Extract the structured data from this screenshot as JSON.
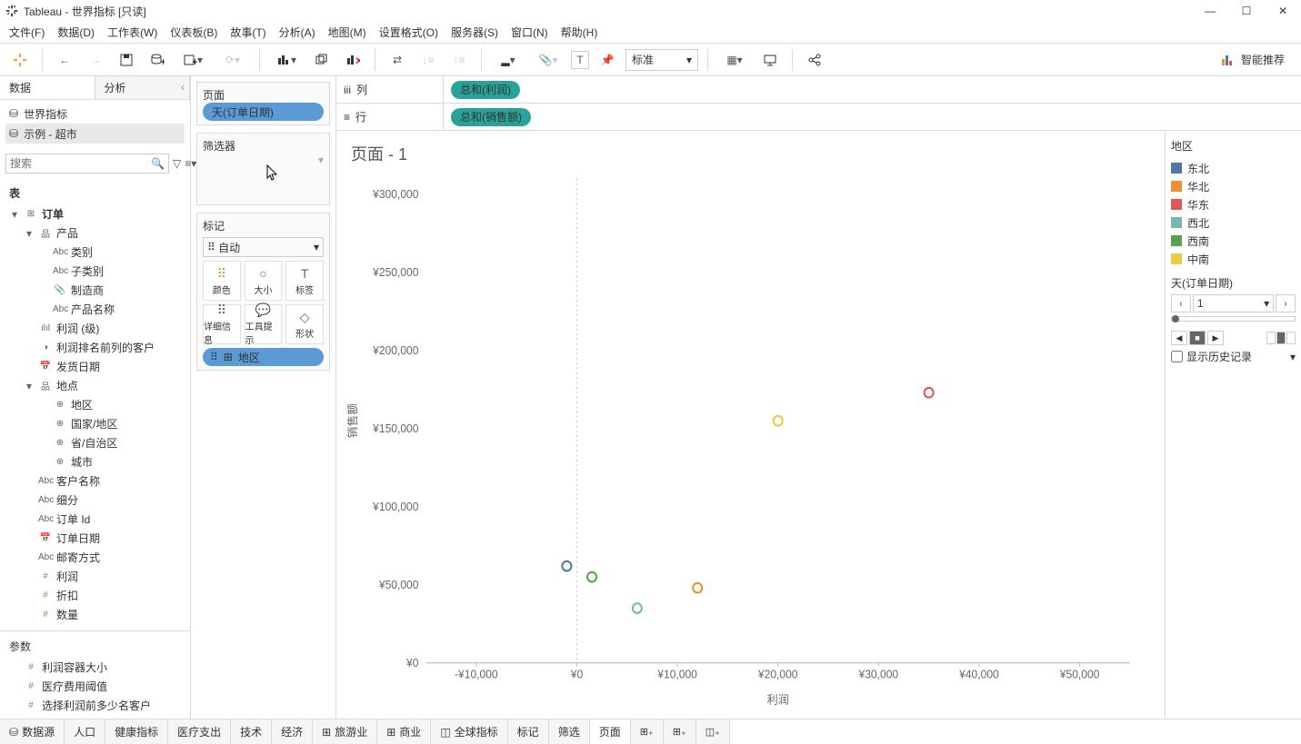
{
  "window": {
    "title": "Tableau - 世界指标 [只读]"
  },
  "menu": [
    "文件(F)",
    "数据(D)",
    "工作表(W)",
    "仪表板(B)",
    "故事(T)",
    "分析(A)",
    "地图(M)",
    "设置格式(O)",
    "服务器(S)",
    "窗口(N)",
    "帮助(H)"
  ],
  "toolbar": {
    "fit": "标准",
    "showme": "智能推荐"
  },
  "left": {
    "data_tab": "数据",
    "analytics_tab": "分析",
    "datasources": [
      {
        "name": "世界指标",
        "selected": false
      },
      {
        "name": "示例 - 超市",
        "selected": true
      }
    ],
    "search_placeholder": "搜索",
    "tables_header": "表",
    "tree": [
      {
        "level": 0,
        "expand": "▾",
        "icon": "⊞",
        "label": "订单",
        "bold": true
      },
      {
        "level": 1,
        "expand": "▾",
        "icon": "品",
        "label": "产品"
      },
      {
        "level": 2,
        "expand": "",
        "icon": "Abc",
        "label": "类别"
      },
      {
        "level": 2,
        "expand": "",
        "icon": "Abc",
        "label": "子类别"
      },
      {
        "level": 2,
        "expand": "",
        "icon": "📎",
        "label": "制造商"
      },
      {
        "level": 2,
        "expand": "",
        "icon": "Abc",
        "label": "产品名称"
      },
      {
        "level": 1,
        "expand": "",
        "icon": "ılıl",
        "label": "利润 (级)"
      },
      {
        "level": 1,
        "expand": "",
        "icon": "◑",
        "label": "利润排名前列的客户"
      },
      {
        "level": 1,
        "expand": "",
        "icon": "📅",
        "label": "发货日期"
      },
      {
        "level": 1,
        "expand": "▾",
        "icon": "品",
        "label": "地点"
      },
      {
        "level": 2,
        "expand": "",
        "icon": "⊕",
        "label": "地区"
      },
      {
        "level": 2,
        "expand": "",
        "icon": "⊕",
        "label": "国家/地区"
      },
      {
        "level": 2,
        "expand": "",
        "icon": "⊕",
        "label": "省/自治区"
      },
      {
        "level": 2,
        "expand": "",
        "icon": "⊕",
        "label": "城市"
      },
      {
        "level": 1,
        "expand": "",
        "icon": "Abc",
        "label": "客户名称"
      },
      {
        "level": 1,
        "expand": "",
        "icon": "Abc",
        "label": "细分"
      },
      {
        "level": 1,
        "expand": "",
        "icon": "Abc",
        "label": "订单 Id"
      },
      {
        "level": 1,
        "expand": "",
        "icon": "📅",
        "label": "订单日期"
      },
      {
        "level": 1,
        "expand": "",
        "icon": "Abc",
        "label": "邮寄方式"
      },
      {
        "level": 1,
        "expand": "",
        "icon": "#",
        "label": "利润",
        "green": true
      },
      {
        "level": 1,
        "expand": "",
        "icon": "#",
        "label": "折扣",
        "green": true
      },
      {
        "level": 1,
        "expand": "",
        "icon": "#",
        "label": "数量",
        "green": true
      }
    ],
    "params_header": "参数",
    "params": [
      {
        "icon": "#",
        "label": "利润容器大小"
      },
      {
        "icon": "#",
        "label": "医疗费用阈值"
      },
      {
        "icon": "#",
        "label": "选择利润前多少名客户"
      }
    ]
  },
  "cards": {
    "pages": {
      "title": "页面",
      "pill": "天(订单日期)"
    },
    "filters": {
      "title": "筛选器"
    },
    "marks": {
      "title": "标记",
      "type": "自动",
      "cells": [
        "颜色",
        "大小",
        "标签",
        "详细信息",
        "工具提示",
        "形状"
      ],
      "pill": {
        "icon": "∷",
        "field_icon": "⊞",
        "label": "地区"
      }
    }
  },
  "shelves": {
    "columns": {
      "label": "列",
      "pill": "总和(利润)"
    },
    "rows": {
      "label": "行",
      "pill": "总和(销售额)"
    }
  },
  "chart_title": "页面 - 1",
  "chart_data": {
    "type": "scatter",
    "xlabel": "利润",
    "ylabel": "销售额",
    "xlim": [
      -15000,
      55000
    ],
    "ylim": [
      0,
      310000
    ],
    "x_ticks": [
      -10000,
      0,
      10000,
      20000,
      30000,
      40000,
      50000
    ],
    "x_tick_labels": [
      "-¥10,000",
      "¥0",
      "¥10,000",
      "¥20,000",
      "¥30,000",
      "¥40,000",
      "¥50,000"
    ],
    "y_ticks": [
      0,
      50000,
      100000,
      150000,
      200000,
      250000,
      300000
    ],
    "y_tick_labels": [
      "¥0",
      "¥50,000",
      "¥100,000",
      "¥150,000",
      "¥200,000",
      "¥250,000",
      "¥300,000"
    ],
    "points": [
      {
        "region": "东北",
        "x": -1000,
        "y": 62000,
        "color": "#4e79a7"
      },
      {
        "region": "华北",
        "x": 12000,
        "y": 48000,
        "color": "#f28e2b"
      },
      {
        "region": "华东",
        "x": 35000,
        "y": 173000,
        "color": "#e15759"
      },
      {
        "region": "西北",
        "x": 6000,
        "y": 35000,
        "color": "#76b7b2"
      },
      {
        "region": "西南",
        "x": 1500,
        "y": 55000,
        "color": "#59a14f"
      },
      {
        "region": "中南",
        "x": 20000,
        "y": 155000,
        "color": "#edc948"
      }
    ]
  },
  "legend": {
    "title": "地区",
    "items": [
      {
        "label": "东北",
        "color": "#4e79a7"
      },
      {
        "label": "华北",
        "color": "#f28e2b"
      },
      {
        "label": "华东",
        "color": "#e15759"
      },
      {
        "label": "西北",
        "color": "#76b7b2"
      },
      {
        "label": "西南",
        "color": "#59a14f"
      },
      {
        "label": "中南",
        "color": "#edc948"
      }
    ]
  },
  "page_control": {
    "title": "天(订单日期)",
    "current": "1",
    "show_history": "显示历史记录"
  },
  "bottom": {
    "datasource": "数据源",
    "tabs": [
      "人口",
      "健康指标",
      "医疗支出",
      "技术",
      "经济",
      "旅游业",
      "商业",
      "全球指标",
      "标记",
      "筛选",
      "页面"
    ]
  }
}
